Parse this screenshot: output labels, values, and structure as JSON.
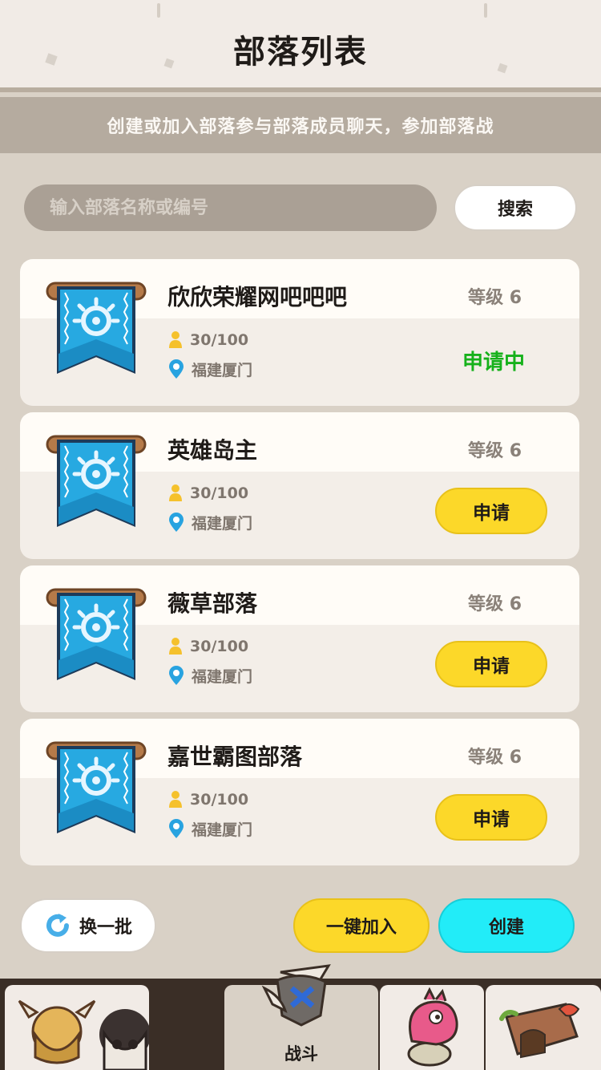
{
  "header": {
    "title": "部落列表",
    "subtitle": "创建或加入部落参与部落成员聊天，参加部落战"
  },
  "search": {
    "placeholder": "输入部落名称或编号",
    "button_label": "搜索"
  },
  "tribes": [
    {
      "name": "欣欣荣耀网吧吧吧",
      "level": "等级 6",
      "members": "30/100",
      "location": "福建厦门",
      "action": "申请中",
      "action_state": "pending"
    },
    {
      "name": "英雄岛主",
      "level": "等级 6",
      "members": "30/100",
      "location": "福建厦门",
      "action": "申请",
      "action_state": "apply"
    },
    {
      "name": "薇草部落",
      "level": "等级 6",
      "members": "30/100",
      "location": "福建厦门",
      "action": "申请",
      "action_state": "apply"
    },
    {
      "name": "嘉世霸图部落",
      "level": "等级 6",
      "members": "30/100",
      "location": "福建厦门",
      "action": "申请",
      "action_state": "apply"
    }
  ],
  "footer": {
    "refresh_label": "换一批",
    "join_label": "一键加入",
    "create_label": "创建"
  },
  "nav": {
    "items": [
      {
        "icon": "viking-character-icon",
        "label": ""
      },
      {
        "icon": "skull-warrior-icon",
        "label": ""
      },
      {
        "icon": "battle-sword-icon",
        "label": "战斗",
        "active": true
      },
      {
        "icon": "pink-monster-icon",
        "label": ""
      },
      {
        "icon": "shop-hut-icon",
        "label": ""
      }
    ]
  },
  "colors": {
    "background": "#d9d1c6",
    "banner_blue": "#27a9e1",
    "apply_yellow": "#fcd829",
    "create_cyan": "#22ecf8",
    "pending_green": "#16b11b"
  }
}
